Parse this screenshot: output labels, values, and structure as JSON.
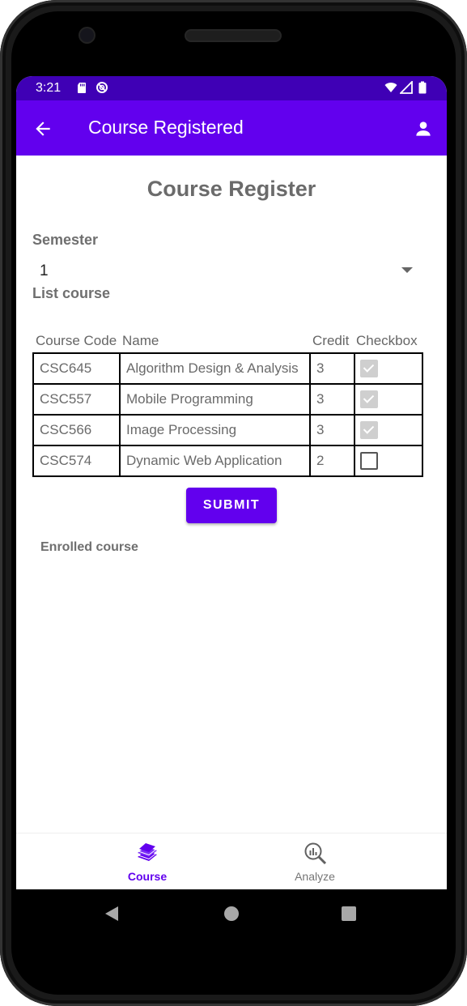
{
  "status_bar": {
    "time": "3:21"
  },
  "app_bar": {
    "title": "Course Registered"
  },
  "page": {
    "heading": "Course Register",
    "semester_label": "Semester",
    "semester_value": "1",
    "list_label": "List course",
    "table_headers": {
      "code": "Course Code",
      "name": "Name",
      "credit": "Credit",
      "checkbox": "Checkbox"
    },
    "courses": [
      {
        "code": "CSC645",
        "name": "Algorithm Design & Analysis",
        "credit": "3",
        "checked": true,
        "enabled": false
      },
      {
        "code": "CSC557",
        "name": "Mobile Programming",
        "credit": "3",
        "checked": true,
        "enabled": false
      },
      {
        "code": "CSC566",
        "name": "Image Processing",
        "credit": "3",
        "checked": true,
        "enabled": false
      },
      {
        "code": "CSC574",
        "name": "Dynamic Web Application",
        "credit": "2",
        "checked": false,
        "enabled": true
      }
    ],
    "submit_label": "SUBMIT",
    "enrolled_label": "Enrolled course"
  },
  "bottom_nav": {
    "items": [
      {
        "label": "Course",
        "icon": "book-stack-icon",
        "active": true
      },
      {
        "label": "Analyze",
        "icon": "analytics-search-icon",
        "active": false
      }
    ]
  },
  "colors": {
    "primary": "#6200ee",
    "status_bar": "#3f00b5",
    "inactive_nav": "#757575"
  }
}
